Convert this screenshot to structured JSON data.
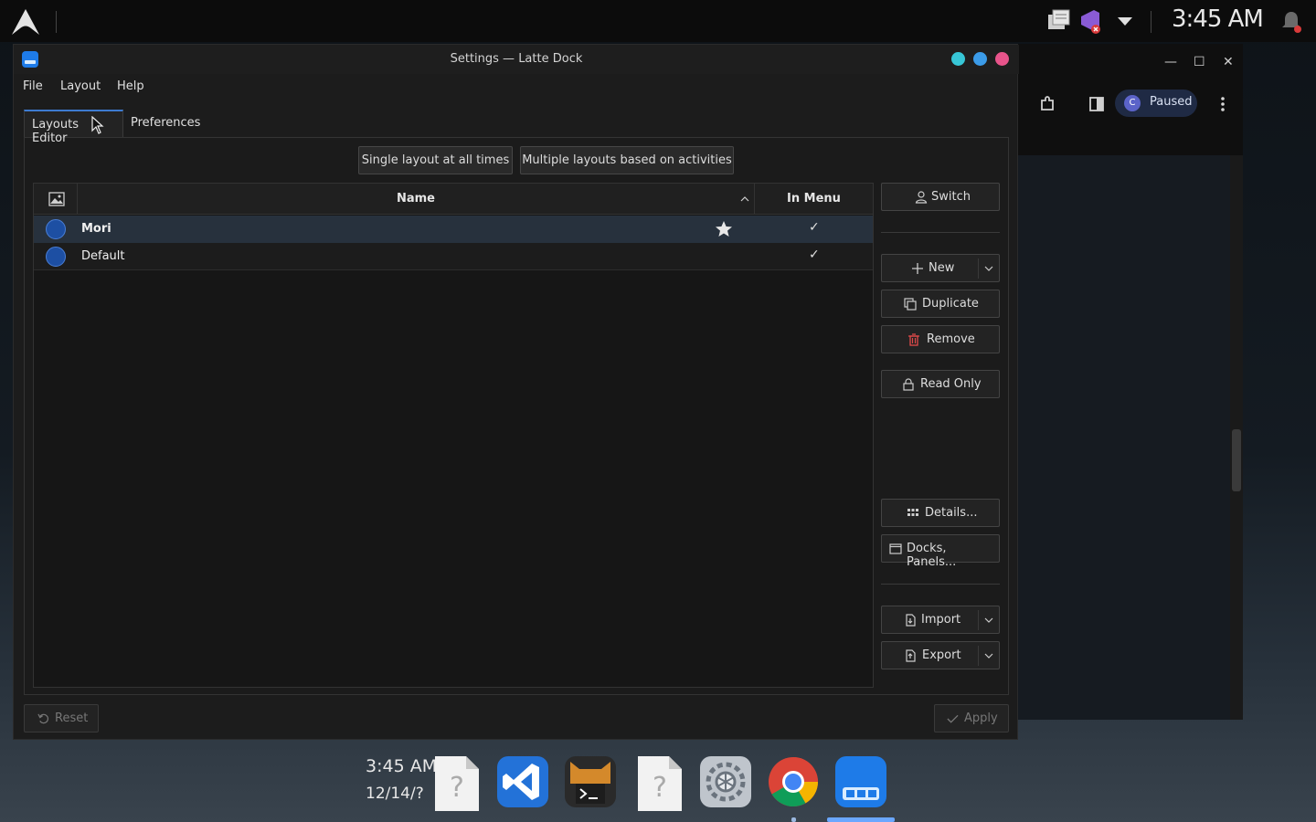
{
  "top_panel": {
    "clock": "3:45 AM",
    "icons": [
      "arch-logo-icon",
      "clipboard-icon",
      "visual-studio-icon",
      "dropdown-arrow-icon",
      "notification-bell-icon"
    ]
  },
  "background_window": {
    "paused_initial": "C",
    "paused_label": "Paused"
  },
  "window": {
    "title": "Settings — Latte Dock",
    "menu": [
      "File",
      "Layout",
      "Help"
    ],
    "tabs": [
      "Layouts Editor",
      "Preferences"
    ],
    "modes": [
      "Single layout at all times",
      "Multiple layouts based on activities"
    ],
    "table": {
      "headers": {
        "name": "Name",
        "in_menu": "In Menu"
      },
      "rows": [
        {
          "name": "Mori",
          "active": true,
          "in_menu": "✓"
        },
        {
          "name": "Default",
          "active": false,
          "in_menu": "✓"
        }
      ]
    },
    "buttons": {
      "switch": "Switch",
      "new": "New",
      "duplicate": "Duplicate",
      "remove": "Remove",
      "read_only": "Read Only",
      "details": "Details...",
      "docks_panels": "Docks, Panels...",
      "import": "Import",
      "export": "Export",
      "reset": "Reset",
      "apply": "Apply"
    },
    "colors": {
      "close": "#e8548b",
      "maximize": "#3b9be8",
      "minimize": "#37c6d6",
      "accent": "#3d7bd0",
      "remove_icon": "#e04a4a"
    }
  },
  "dock": {
    "time": "3:45 AM",
    "date": "12/14/?",
    "apps": [
      "unknown-file-icon",
      "vscode-icon",
      "terminal-cat-icon",
      "unknown-file-icon",
      "system-settings-icon",
      "chrome-icon",
      "latte-dock-icon"
    ]
  }
}
